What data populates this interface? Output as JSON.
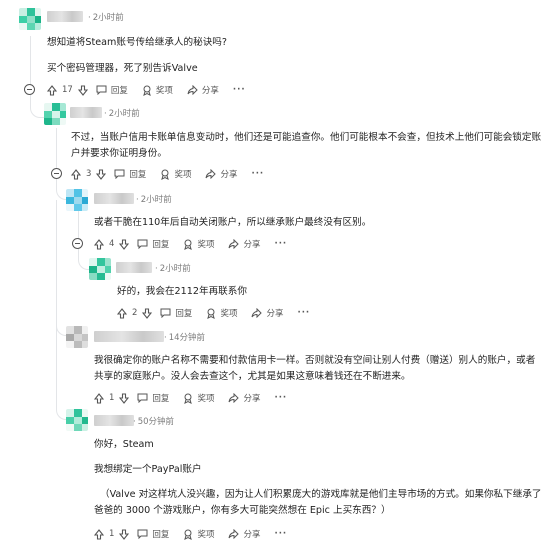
{
  "actions": {
    "reply": "回复",
    "award": "奖项",
    "share": "分享",
    "more": "···"
  },
  "comments": [
    {
      "id": "c1",
      "time": "2小时前",
      "score": "",
      "paras": [
        "想知道将Steam账号传给继承人的秘诀吗?",
        "买个密码管理器，死了别告诉Valve"
      ],
      "score_after": "17"
    },
    {
      "id": "c2",
      "time": "2小时前",
      "paras": [
        "不过，当账户信用卡账单信息变动时，他们还是可能追查你。他们可能根本不会查，但技术上他们可能会锁定账户并要求你证明身份。"
      ],
      "score_after": "3"
    },
    {
      "id": "c3",
      "time": "2小时前",
      "paras": [
        "或者干脆在110年后自动关闭账户，所以继承账户最终没有区别。"
      ],
      "score_after": "4"
    },
    {
      "id": "c4",
      "time": "2小时前",
      "paras": [
        "好的，我会在2112年再联系你"
      ],
      "score_after": "2"
    },
    {
      "id": "c5",
      "time": "14分钟前",
      "paras": [
        "我很确定你的账户名称不需要和付款信用卡一样。否则就没有空间让别人付费（赠送）别人的账户，或者共享的家庭账户。没人会去查这个，尤其是如果这意味着钱还在不断进来。"
      ],
      "score_after": "1"
    },
    {
      "id": "c6",
      "time": "50分钟前",
      "paras": [
        "你好，Steam",
        "我想绑定一个PayPal账户",
        "（Valve 对这样坑人没兴趣，因为让人们积累庞大的游戏库就是他们主导市场的方式。如果你私下继承了爸爸的 3000 个游戏账户，你有多大可能突然想在 Epic 上买东西？）"
      ],
      "score_after": "1"
    }
  ]
}
